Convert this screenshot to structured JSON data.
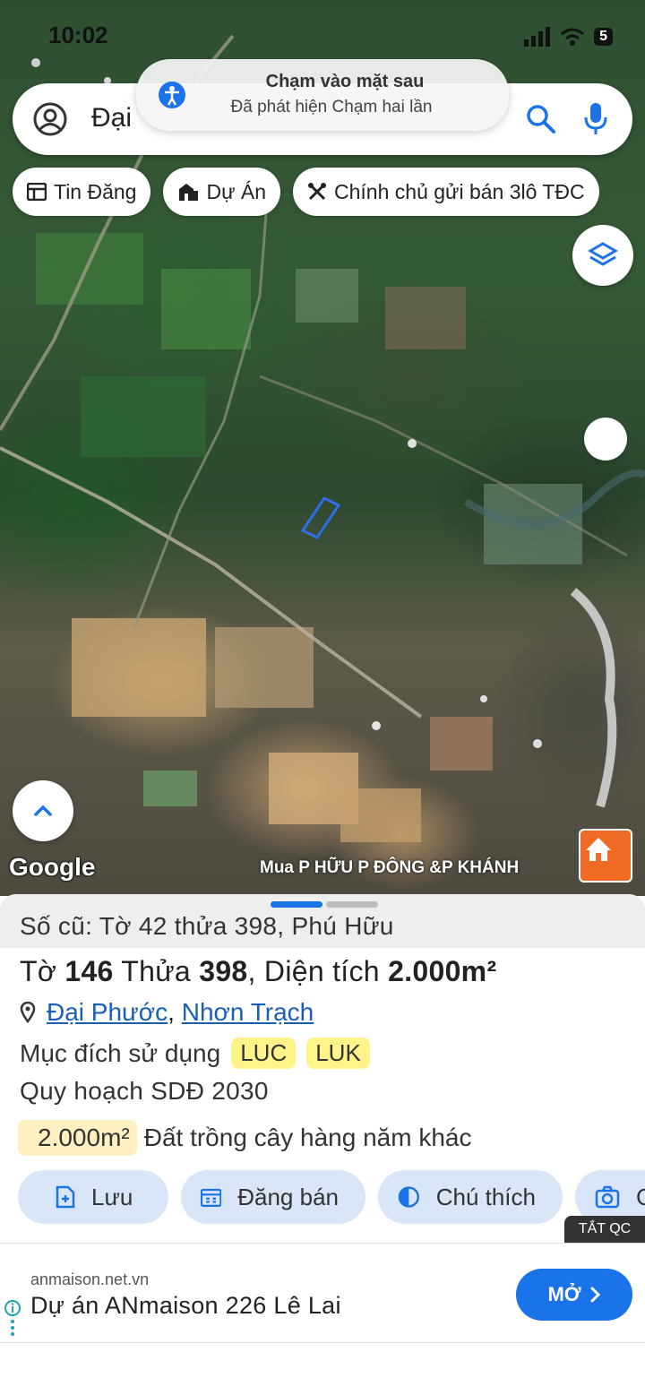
{
  "status_bar": {
    "time": "10:02",
    "battery": "5"
  },
  "search": {
    "text": "Đại"
  },
  "toast": {
    "title": "Chạm vào mặt sau",
    "subtitle": "Đã phát hiện Chạm hai lần"
  },
  "chips": [
    {
      "label": "Tin Đăng",
      "icon": "newspaper-icon"
    },
    {
      "label": "Dự Án",
      "icon": "building-icon"
    },
    {
      "label": "Chính chủ gửi bán 3lô TĐC",
      "icon": "tools-icon"
    }
  ],
  "map": {
    "logo": "Google",
    "overlay_text": "Mua P HỮU P ĐÔNG &P KHÁNH"
  },
  "parcel": {
    "old_info": "Số cũ: Tờ 42 thửa 398, Phú Hữu",
    "sheet_label": "Tờ",
    "sheet_no": "146",
    "plot_label": "Thửa",
    "plot_no": "398",
    "area_label": ", Diện tích",
    "area_value": "2.000m²",
    "ward": "Đại Phước",
    "separator": ",",
    "district": "Nhơn Trạch",
    "purpose_label": "Mục đích sử dụng",
    "purpose_tags": [
      "LUC",
      "LUK"
    ],
    "plan_label": "Quy hoạch SDĐ 2030",
    "plan_area": "2.000m²",
    "plan_use": "Đất trồng cây hàng năm khác"
  },
  "actions": [
    {
      "label": "Lưu",
      "icon": "save-icon"
    },
    {
      "label": "Đăng bán",
      "icon": "calendar-icon"
    },
    {
      "label": "Chú thích",
      "icon": "contrast-icon"
    },
    {
      "label": "C",
      "icon": "camera-icon"
    }
  ],
  "ad": {
    "close_label": "TẮT QC",
    "domain": "anmaison.net.vn",
    "title": "Dự án ANmaison 226 Lê Lai",
    "button": "MỞ"
  },
  "colors": {
    "accent": "#1a73e8",
    "link": "#1a5fb4",
    "tag_bg": "#fff38a",
    "action_bg": "#d9e6f7"
  }
}
